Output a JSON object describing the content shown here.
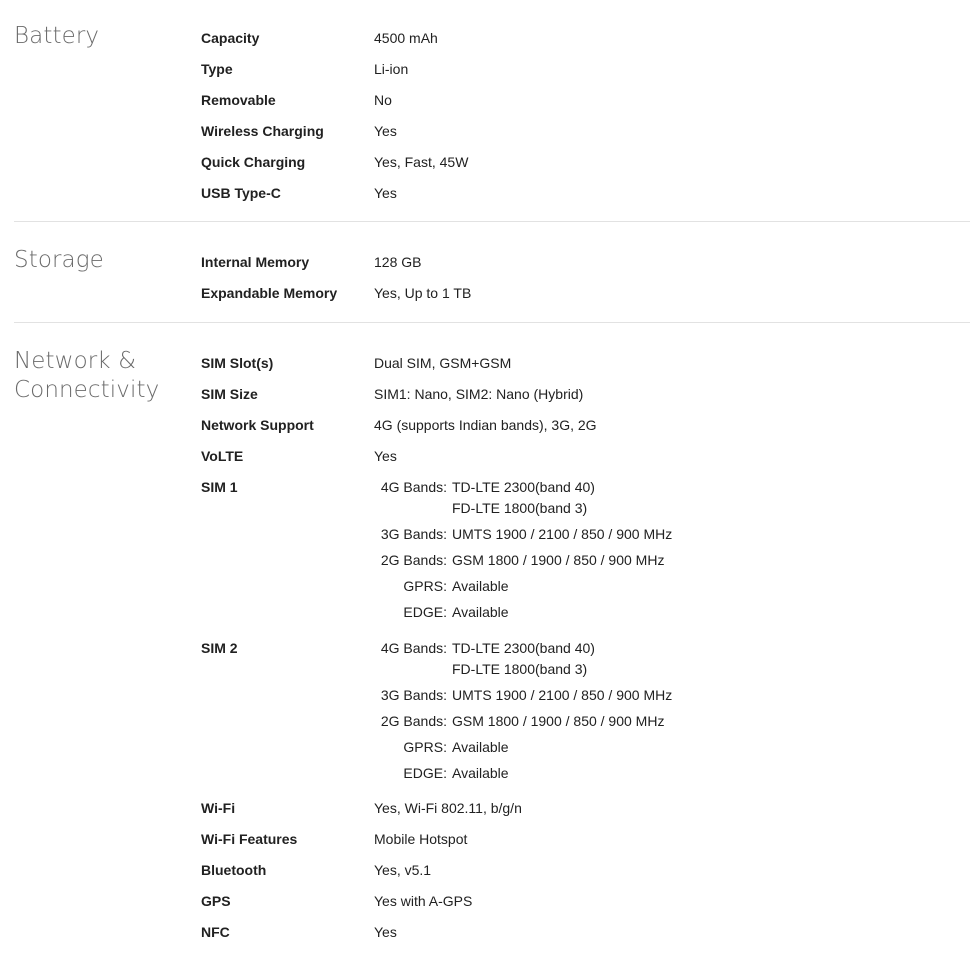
{
  "battery": {
    "title": "Battery",
    "rows": [
      {
        "key": "Capacity",
        "value": "4500 mAh"
      },
      {
        "key": "Type",
        "value": "Li-ion"
      },
      {
        "key": "Removable",
        "value": "No"
      },
      {
        "key": "Wireless Charging",
        "value": "Yes"
      },
      {
        "key": "Quick Charging",
        "value": "Yes, Fast, 45W"
      },
      {
        "key": "USB Type-C",
        "value": "Yes"
      }
    ]
  },
  "storage": {
    "title": "Storage",
    "rows": [
      {
        "key": "Internal Memory",
        "value": "128 GB"
      },
      {
        "key": "Expandable Memory",
        "value": "Yes, Up to 1 TB"
      }
    ]
  },
  "network": {
    "title_line1": "Network &",
    "title_line2": "Connectivity",
    "rows": [
      {
        "key": "SIM Slot(s)",
        "value": "Dual SIM, GSM+GSM"
      },
      {
        "key": "SIM Size",
        "value": "SIM1: Nano, SIM2: Nano (Hybrid)"
      },
      {
        "key": "Network Support",
        "value": "4G (supports Indian bands), 3G, 2G"
      },
      {
        "key": "VoLTE",
        "value": "Yes"
      }
    ],
    "sim1": {
      "key": "SIM 1",
      "bands": {
        "g4_label": "4G Bands:",
        "g4_value1": "TD-LTE 2300(band 40)",
        "g4_value2": "FD-LTE 1800(band 3)",
        "g3_label": "3G Bands:",
        "g3_value": "UMTS 1900 / 2100 / 850 / 900 MHz",
        "g2_label": "2G Bands:",
        "g2_value": "GSM 1800 / 1900 / 850 / 900 MHz",
        "gprs_label": "GPRS:",
        "gprs_value": "Available",
        "edge_label": "EDGE:",
        "edge_value": "Available"
      }
    },
    "sim2": {
      "key": "SIM 2",
      "bands": {
        "g4_label": "4G Bands:",
        "g4_value1": "TD-LTE 2300(band 40)",
        "g4_value2": "FD-LTE 1800(band 3)",
        "g3_label": "3G Bands:",
        "g3_value": "UMTS 1900 / 2100 / 850 / 900 MHz",
        "g2_label": "2G Bands:",
        "g2_value": "GSM 1800 / 1900 / 850 / 900 MHz",
        "gprs_label": "GPRS:",
        "gprs_value": "Available",
        "edge_label": "EDGE:",
        "edge_value": "Available"
      }
    },
    "rows2": [
      {
        "key": "Wi-Fi",
        "value": "Yes, Wi-Fi 802.11, b/g/n"
      },
      {
        "key": "Wi-Fi Features",
        "value": "Mobile Hotspot"
      },
      {
        "key": "Bluetooth",
        "value": "Yes, v5.1"
      },
      {
        "key": "GPS",
        "value": "Yes with A-GPS"
      },
      {
        "key": "NFC",
        "value": "Yes"
      }
    ]
  }
}
